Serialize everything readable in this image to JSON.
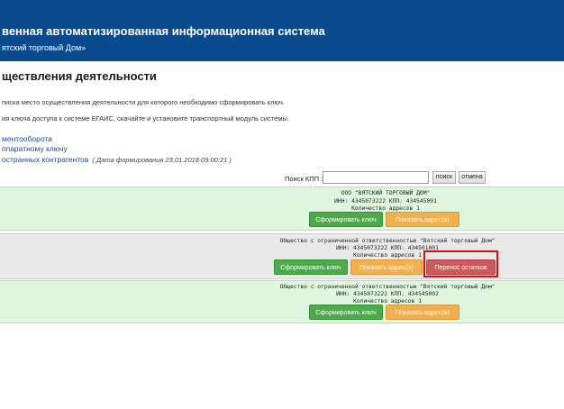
{
  "header": {
    "title": "венная автоматизированная информационная система",
    "org": "ятский торговый Дом»"
  },
  "page": {
    "title": "ществления деятельности",
    "instruction_1": "писка место осуществления деятельности для которого необходимо сформировать ключ.",
    "instruction_2": "ия ключа доступа к системе ЕГАИС, скачайте и установите транспортный модуль системы.",
    "links": [
      "ментооборота",
      "ппаратному ключу",
      "остранных контрагентов"
    ],
    "formed_note": "( Дата формирования 23.01.2018 09:00:21 )"
  },
  "search": {
    "label": "Поиск КПП :",
    "value": "",
    "placeholder": "",
    "search_button": "поиск",
    "cancel_button": "отмена"
  },
  "organizations": [
    {
      "name": "ООО \"ВЯТСКИЙ ТОРГОВЫЙ ДОМ\"",
      "ids": "ИНН: 4345073222 КПП: 434545001",
      "count": "Количество адресов 1",
      "buttons": {
        "generate": "Сформировать ключ",
        "show": "Показать адрес(а)"
      }
    },
    {
      "name": "Общество с ограниченной ответственностью \"Вятский торговый Дом\"",
      "ids": "ИНН: 4345073222 КПП: 434501001",
      "count": "Количество адресов 1",
      "buttons": {
        "generate": "Сформировать ключ",
        "show": "Показать адрес(а)",
        "transfer": "Перенос остатков"
      }
    },
    {
      "name": "Общество с ограниченной ответственностью \"Вятский торговый Дом\"",
      "ids": "ИНН: 4345073222 КПП: 434545002",
      "count": "Количество адресов 1",
      "buttons": {
        "generate": "Сформировать ключ",
        "show": "Показать адрес(а)"
      }
    }
  ],
  "colors": {
    "header_bg": "#0a4a8f",
    "entry_green": "#e0f7df",
    "entry_gray": "#e9e9e9",
    "btn_green": "#4daa4a",
    "btn_orange": "#f0b050",
    "btn_red": "#cc5a5a",
    "highlight_frame": "#d01010"
  }
}
